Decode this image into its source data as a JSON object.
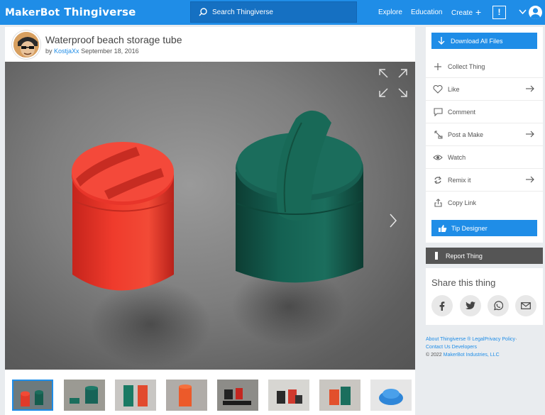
{
  "header": {
    "logo_part1": "MakerBot",
    "logo_part2": "Thingiverse",
    "search_placeholder": "Search Thingiverse",
    "nav_explore": "Explore",
    "nav_education": "Education",
    "nav_create": "Create",
    "alert_glyph": "!",
    "accent_color": "#1f8de7"
  },
  "thing": {
    "title": "Waterproof beach storage tube",
    "by_prefix": "by",
    "author": "KostjaXx",
    "date": "September 18, 2016"
  },
  "gallery": {
    "thumbnail_count": 8,
    "active_index": 0
  },
  "sidebar": {
    "download_label": "Download All Files",
    "actions": [
      {
        "label": "Collect Thing",
        "icon": "plus-icon",
        "arrow": false
      },
      {
        "label": "Like",
        "icon": "heart-icon",
        "arrow": true
      },
      {
        "label": "Comment",
        "icon": "comment-icon",
        "arrow": false
      },
      {
        "label": "Post a Make",
        "icon": "make-icon",
        "arrow": true
      },
      {
        "label": "Watch",
        "icon": "eye-icon",
        "arrow": false
      },
      {
        "label": "Remix it",
        "icon": "remix-icon",
        "arrow": true
      },
      {
        "label": "Copy Link",
        "icon": "share-link-icon",
        "arrow": false
      }
    ],
    "tip_label": "Tip Designer",
    "report_label": "Report Thing"
  },
  "share": {
    "title": "Share this thing",
    "buttons": [
      "facebook-icon",
      "twitter-icon",
      "whatsapp-icon",
      "email-icon"
    ]
  },
  "footer": {
    "about": "About Thingiverse",
    "legal": "® Legal",
    "privacy": "Privacy Policy",
    "dot": "·",
    "contact": "Contact Us",
    "developers": "Developers",
    "copyright_prefix": "©  2022",
    "company": "MakerBot Industries, LLC"
  }
}
